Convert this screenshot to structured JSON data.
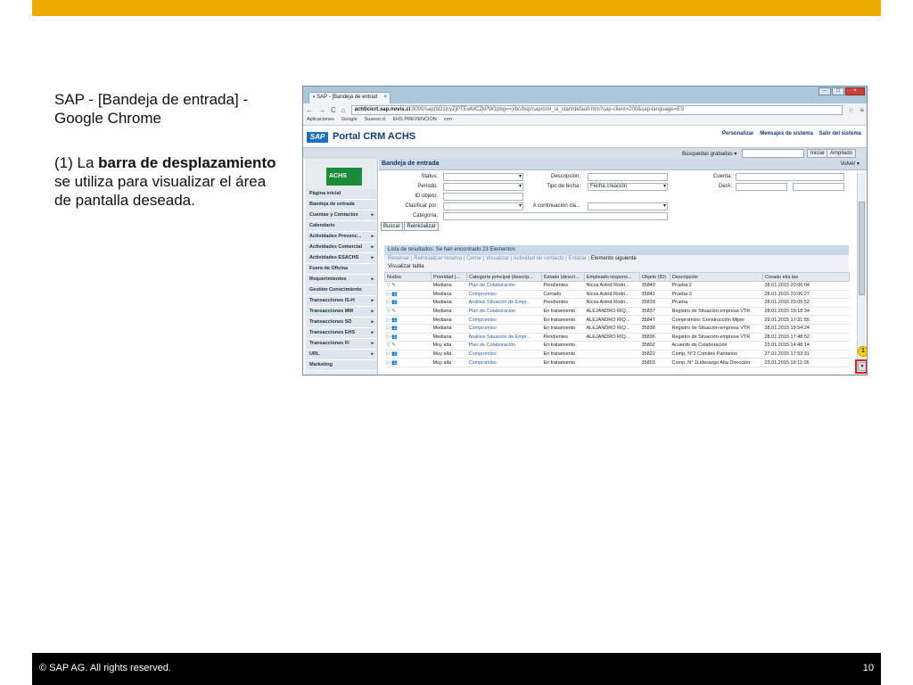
{
  "slide": {
    "title": "SAP - [Bandeja de entrada] - Google Chrome",
    "body_prefix": "(1) La ",
    "body_bold": "barra de desplazamiento",
    "body_suffix": " se utiliza para visualizar el área de pantalla deseada.",
    "footer_left": "©  SAP AG. All rights reserved.",
    "footer_right": "10",
    "accent_color": "#f0ab00"
  },
  "browser": {
    "tab_title": "SAP - [Bandeja de entrad",
    "tab_close": "×",
    "url_host": "achticicrt.sap.novis.cl",
    "url_rest": ":8000/sap(bD1lcyZjPTEwMCZkPW1pbg==)/bc/bsp/sap/crm_ui_start/default.htm?sap-client=200&sap-language=ES",
    "bookmarks": [
      "Aplicaciones",
      "Google",
      "Suseso.cl",
      "EHS PREVENCION",
      "crm"
    ]
  },
  "sap": {
    "logo": "SAP",
    "portal_title": "Portal CRM ACHS",
    "header_links": [
      "Personalizar",
      "Mensajes de sistema",
      "Salir del sistema"
    ],
    "saved_searches_label": "Búsquedas grabadas ▾",
    "btn_iniciar": "Iniciar",
    "btn_ampliado": "Ampliado",
    "achs_logo": "ACHS",
    "nav_items": [
      {
        "label": "Página inicial",
        "arrow": ""
      },
      {
        "label": "Bandeja de entrada",
        "arrow": ""
      },
      {
        "label": "Cuentas y Contactos",
        "arrow": "▸"
      },
      {
        "label": "Calendario",
        "arrow": ""
      },
      {
        "label": "Actividades Prevenc...",
        "arrow": "▸"
      },
      {
        "label": "Actividades Comercial",
        "arrow": "▸"
      },
      {
        "label": "Actividades ESACHS",
        "arrow": "▸"
      },
      {
        "label": "Fuera de Oficina",
        "arrow": ""
      },
      {
        "label": "Requerimientos",
        "arrow": "▸"
      },
      {
        "label": "Gestión Conocimiento",
        "arrow": ""
      },
      {
        "label": "Transacciones IS-H",
        "arrow": "▸"
      },
      {
        "label": "Transacciones MM",
        "arrow": "▸"
      },
      {
        "label": "Transacciones SD",
        "arrow": "▸"
      },
      {
        "label": "Transacciones EHS",
        "arrow": "▸"
      },
      {
        "label": "Transacciones FI",
        "arrow": "▸"
      },
      {
        "label": "URL",
        "arrow": "▸"
      },
      {
        "label": "Marketing",
        "arrow": ""
      }
    ],
    "inbox_title": "Bandeja de entrada",
    "volver": "Volver ▾",
    "form": {
      "status_label": "Status:",
      "periodo_label": "Período:",
      "id_objeto_label": "ID objeto:",
      "clasificar_label": "Clasificar por:",
      "categoria_label": "Categoría:",
      "descripcion_label": "Descripción:",
      "tipo_fecha_label": "Tipo de fecha:",
      "tipo_fecha_value": "Fecha creación",
      "continuacion_label": "A continuación cla...",
      "cuenta_label": "Cuenta:",
      "dea_label": "De/A:",
      "buscar": "Buscar",
      "reinicializar": "Reinicializar"
    },
    "results": {
      "header": "Lista de resultados: Se han encontrado 23 Elementos",
      "toolbar": [
        "Reservar",
        "Reinicializar reserva",
        "Cerrar",
        "Visualizar",
        "Actividad de contacto",
        "Enlazar"
      ],
      "toolbar_active": "Elemento siguiente",
      "show_table": "Visualizar tabla",
      "columns": [
        "Nodos",
        "Prioridad (...",
        "Categoría principal (descrip...",
        "Estado (descri...",
        "Empleado respons...",
        "Objeto (ID)",
        "Descripción",
        "Creado el/a las"
      ],
      "rows": [
        [
          "▽ ✎",
          "Mediana",
          "Plan de Colaboración",
          "Pendientes",
          "Nicxa Astrid Rodri...",
          "35840",
          "Prueba 2",
          "28.01.2015 20:06:04"
        ],
        [
          "▷ 👥",
          "Mediana",
          "Compromiso",
          "Cerrado",
          "Nicxa Astrid Rodri...",
          "35841",
          "Prueba 3",
          "28.01.2015 20:06:27"
        ],
        [
          "▷ 👥",
          "Mediana",
          "Análisis Situación de Empr...",
          "Pendientes",
          "Nicxa Astrid Rodri...",
          "35839",
          "Prueba",
          "28.01.2015 20:05:52"
        ],
        [
          "▽ ✎",
          "Mediana",
          "Plan de Colaboración",
          "En tratamiento",
          "ALEJANDRO RIQ...",
          "35837",
          "Registro de Situación empresa VTR",
          "28.01.2015 19:18:34"
        ],
        [
          "▷ 👥",
          "Mediana",
          "Compromiso",
          "En tratamiento",
          "ALEJANDRO RIQ...",
          "35847",
          "Compromiso: Construcción Miper",
          "29.01.2015 17:31:55"
        ],
        [
          "▷ 👥",
          "Mediana",
          "Compromiso",
          "En tratamiento",
          "ALEJANDRO RIQ...",
          "35838",
          "Registro de Situación empresa VTR",
          "28.01.2015 19:54:24"
        ],
        [
          "▷ 👥",
          "Mediana",
          "Análisis Situación de Empr...",
          "Pendientes",
          "ALEJANDRO RIQ...",
          "35836",
          "Registro de Situación empresa VTR",
          "28.01.2015 17:48:52"
        ],
        [
          "▽ ✎",
          "Muy alta",
          "Plan de Colaboración",
          "En tratamiento",
          "",
          "35802",
          "Acuerdo de Colaboración",
          "23.01.2015 14:48:14"
        ],
        [
          "▷ 👥",
          "Muy alta",
          "Compromiso",
          "En tratamiento",
          "",
          "35822",
          "Comp. N°2 Comités Paritarios",
          "27.01.2015 17:53:31"
        ],
        [
          "▷ 👥",
          "Muy alta",
          "Compromiso",
          "En tratamiento",
          "",
          "35803",
          "Comp. N° 1Liderazgo Alta Dirección",
          "23.01.2015 19:11:05"
        ]
      ]
    },
    "callout_number": "1"
  }
}
